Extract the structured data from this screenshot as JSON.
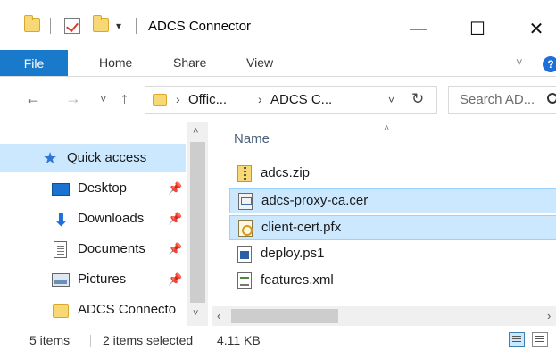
{
  "window": {
    "title": "ADCS Connector",
    "minimize_glyph": "—",
    "maximize_glyph": "☐",
    "close_glyph": "✕",
    "quick_access_dropdown": "▾"
  },
  "ribbon": {
    "tabs": [
      "File",
      "Home",
      "Share",
      "View"
    ],
    "expand_glyph": "˅",
    "help_glyph": "?"
  },
  "address_bar": {
    "back_glyph": "←",
    "forward_glyph": "→",
    "recent_glyph": "˅",
    "up_glyph": "↑",
    "breadcrumb": [
      "Offic...",
      "ADCS C..."
    ],
    "crumb_separator": "›",
    "dropdown_glyph": "˅",
    "refresh_glyph": "↻",
    "search_placeholder": "Search AD..."
  },
  "nav_pane": {
    "items": [
      {
        "label": "Quick access",
        "icon": "star-icon",
        "selected": true,
        "pinned": false
      },
      {
        "label": "Desktop",
        "icon": "desktop-icon",
        "selected": false,
        "pinned": true
      },
      {
        "label": "Downloads",
        "icon": "download-arrow-icon",
        "selected": false,
        "pinned": true
      },
      {
        "label": "Documents",
        "icon": "documents-icon",
        "selected": false,
        "pinned": true
      },
      {
        "label": "Pictures",
        "icon": "pictures-icon",
        "selected": false,
        "pinned": true
      },
      {
        "label": "ADCS Connecto",
        "icon": "folder-icon",
        "selected": false,
        "pinned": false
      }
    ],
    "pin_glyph": "📌",
    "scroll_up_glyph": "˄",
    "scroll_down_glyph": "˅"
  },
  "file_list": {
    "column_name": "Name",
    "sort_glyph": "˄",
    "files": [
      {
        "name": "adcs.zip",
        "icon": "zip-icon",
        "selected": false
      },
      {
        "name": "adcs-proxy-ca.cer",
        "icon": "certificate-icon",
        "selected": true
      },
      {
        "name": "client-cert.pfx",
        "icon": "pfx-key-icon",
        "selected": true
      },
      {
        "name": "deploy.ps1",
        "icon": "powershell-icon",
        "selected": false
      },
      {
        "name": "features.xml",
        "icon": "xml-icon",
        "selected": false
      }
    ],
    "scroll_left_glyph": "‹",
    "scroll_right_glyph": "›"
  },
  "status_bar": {
    "item_count": "5 items",
    "selection": "2 items selected",
    "size": "4.11 KB"
  },
  "colors": {
    "accent": "#1979ca",
    "selection_bg": "#cce8ff",
    "folder": "#f8d775"
  }
}
